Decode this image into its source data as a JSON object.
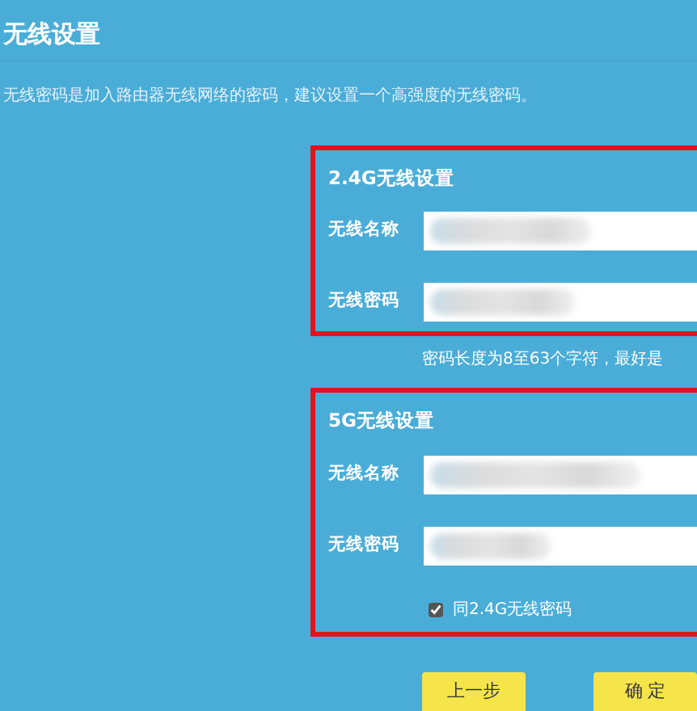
{
  "title": "无线设置",
  "description": "无线密码是加入路由器无线网络的密码，建议设置一个高强度的无线密码。",
  "sections": [
    {
      "heading": "2.4G无线设置",
      "fields": [
        {
          "label": "无线名称",
          "kind": "text"
        },
        {
          "label": "无线密码",
          "kind": "password"
        }
      ],
      "hint": "密码长度为8至63个字符，最好是"
    },
    {
      "heading": "5G无线设置",
      "fields": [
        {
          "label": "无线名称",
          "kind": "text"
        },
        {
          "label": "无线密码",
          "kind": "password"
        }
      ],
      "checkbox": {
        "label": "同2.4G无线密码",
        "checked": true
      }
    }
  ],
  "buttons": [
    {
      "label": "上一步"
    },
    {
      "label": "确 定"
    }
  ]
}
